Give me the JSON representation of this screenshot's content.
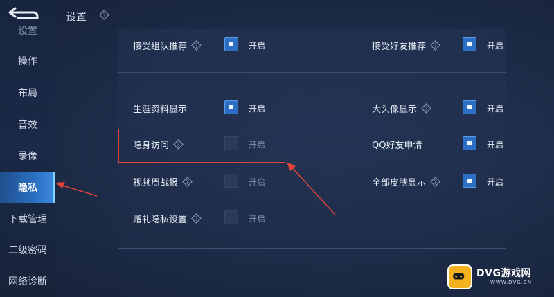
{
  "header": {
    "title": "设置"
  },
  "sidebar": {
    "items": [
      {
        "label": "设置"
      },
      {
        "label": "操作"
      },
      {
        "label": "布局"
      },
      {
        "label": "音效"
      },
      {
        "label": "录像"
      },
      {
        "label": "隐私",
        "active": true
      },
      {
        "label": "下载管理"
      },
      {
        "label": "二级密码"
      },
      {
        "label": "网络诊断"
      }
    ]
  },
  "settings": {
    "toggle_on_text": "开启",
    "left": [
      {
        "label": "接受组队推荐",
        "help": true,
        "checked": true
      },
      {
        "label": "生涯资料显示",
        "help": false,
        "checked": true
      },
      {
        "label": "隐身访问",
        "help": true,
        "checked": false
      },
      {
        "label": "视频周战报",
        "help": true,
        "checked": false
      },
      {
        "label": "赠礼隐私设置",
        "help": true,
        "checked": false
      }
    ],
    "right": [
      {
        "label": "接受好友推荐",
        "help": true,
        "checked": true
      },
      {
        "label": "大头像显示",
        "help": true,
        "checked": true
      },
      {
        "label": "QQ好友申请",
        "help": false,
        "checked": true
      },
      {
        "label": "全部皮肤显示",
        "help": true,
        "checked": true
      }
    ]
  },
  "watermark": {
    "text": "DVG游戏网",
    "sub": "WWW.DVG.CN"
  },
  "colors": {
    "accent": "#2d6fc4",
    "annotation": "#e0443a",
    "background": "#1c2a44"
  }
}
